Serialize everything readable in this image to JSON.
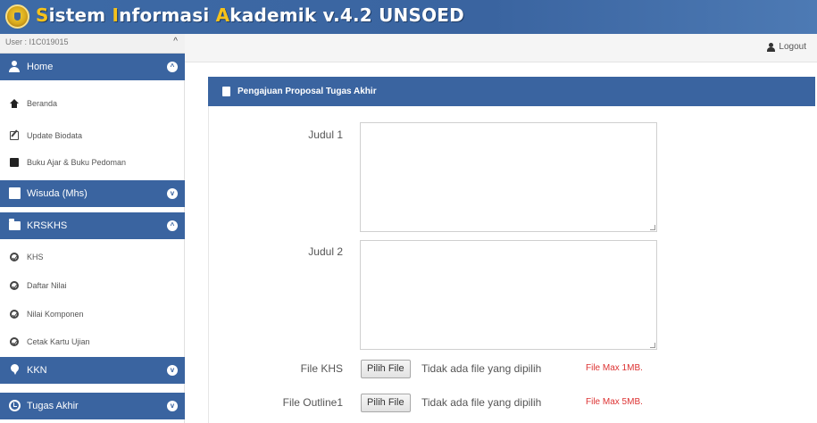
{
  "header": {
    "title_parts": [
      "S",
      "istem ",
      "I",
      "nformasi ",
      "A",
      "kademik v.4.2 UNSOED"
    ]
  },
  "userbar": {
    "user": "User : I1C019015",
    "caret": "^"
  },
  "topbar": {
    "logout": "Logout"
  },
  "sidebar": {
    "home": {
      "label": "Home",
      "toggle": "^"
    },
    "home_items": [
      {
        "label": "Beranda",
        "icon": "home-icon"
      },
      {
        "label": "Update Biodata",
        "icon": "edit-icon"
      },
      {
        "label": "Buku Ajar & Buku Pedoman",
        "icon": "book-icon"
      }
    ],
    "wisuda": {
      "label": "Wisuda (Mhs)",
      "toggle": "v"
    },
    "krskhs": {
      "label": "KRSKHS",
      "toggle": "^"
    },
    "krskhs_items": [
      {
        "label": "KHS",
        "icon": "check-circle-icon"
      },
      {
        "label": "Daftar Nilai",
        "icon": "check-circle-icon"
      },
      {
        "label": "Nilai Komponen",
        "icon": "check-circle-icon"
      },
      {
        "label": "Cetak Kartu Ujian",
        "icon": "check-circle-icon"
      }
    ],
    "kkn": {
      "label": "KKN",
      "toggle": "v"
    },
    "tugas": {
      "label": "Tugas Akhir",
      "toggle": "v"
    }
  },
  "panel": {
    "title": "Pengajuan Proposal Tugas Akhir",
    "judul1_label": "Judul 1",
    "judul2_label": "Judul 2",
    "khs_label": "File KHS",
    "outline_label": "File Outline1",
    "file_button": "Pilih File",
    "no_file": "Tidak ada file yang dipilih",
    "khs_max": "File Max 1MB.",
    "outline_max": "File Max 5MB."
  },
  "colors": {
    "brand": "#3a64a0",
    "accent": "#f6c21a",
    "error": "#dd3333"
  }
}
